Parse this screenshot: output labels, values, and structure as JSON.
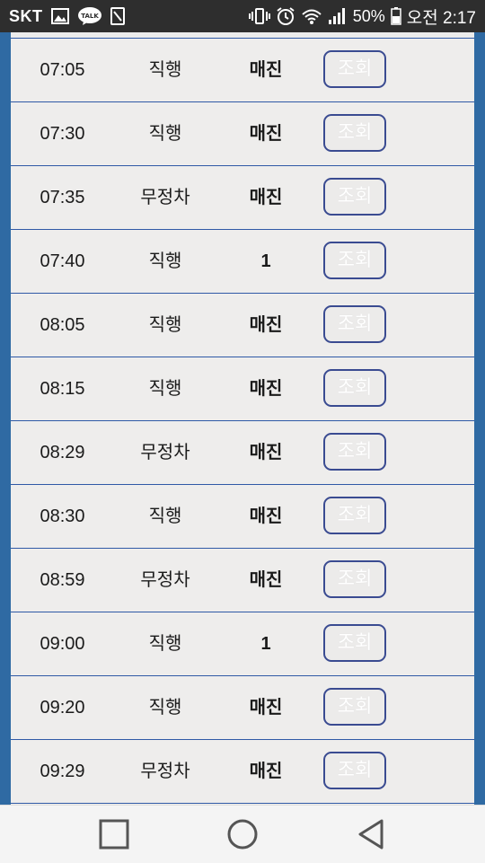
{
  "status_bar": {
    "carrier": "SKT",
    "battery": "50%",
    "time": "오전 2:17",
    "icons": [
      "gallery-icon",
      "kakaotalk-icon",
      "notification-icon",
      "vibrate-icon",
      "alarm-icon",
      "wifi-icon",
      "signal-icon",
      "battery-icon"
    ],
    "kakao_label": "TALK"
  },
  "schedule": {
    "button_label": "조회",
    "rows": [
      {
        "time": "07:05",
        "type": "직행",
        "seats": "매진"
      },
      {
        "time": "07:30",
        "type": "직행",
        "seats": "매진"
      },
      {
        "time": "07:35",
        "type": "무정차",
        "seats": "매진"
      },
      {
        "time": "07:40",
        "type": "직행",
        "seats": "1"
      },
      {
        "time": "08:05",
        "type": "직행",
        "seats": "매진"
      },
      {
        "time": "08:15",
        "type": "직행",
        "seats": "매진"
      },
      {
        "time": "08:29",
        "type": "무정차",
        "seats": "매진"
      },
      {
        "time": "08:30",
        "type": "직행",
        "seats": "매진"
      },
      {
        "time": "08:59",
        "type": "무정차",
        "seats": "매진"
      },
      {
        "time": "09:00",
        "type": "직행",
        "seats": "1"
      },
      {
        "time": "09:20",
        "type": "직행",
        "seats": "매진"
      },
      {
        "time": "09:29",
        "type": "무정차",
        "seats": "매진"
      }
    ]
  },
  "nav_bar": {
    "buttons": [
      "recent-apps-icon",
      "home-icon",
      "back-icon"
    ]
  },
  "colors": {
    "frame": "#2f6aa3",
    "row_border": "#2f59a6",
    "button_border": "#3a4b91",
    "status_bg": "#2e2e2e",
    "nav_bg": "#f4f4f4"
  }
}
